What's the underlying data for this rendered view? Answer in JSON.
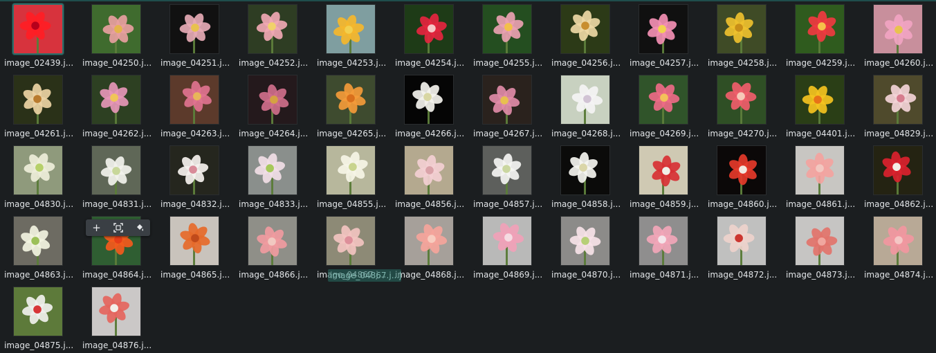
{
  "files": [
    {
      "name": "image_02439.j...",
      "bg": "#d7333d",
      "flower": "#ff1d24",
      "center": "#b7001b",
      "selected": true
    },
    {
      "name": "image_04250.j...",
      "bg": "#3f6b2e",
      "flower": "#e79fa0",
      "center": "#e4b44b"
    },
    {
      "name": "image_04251.j...",
      "bg": "#111111",
      "flower": "#e6aab5",
      "center": "#e8c24e"
    },
    {
      "name": "image_04252.j...",
      "bg": "#2e3d23",
      "flower": "#f0a7b3",
      "center": "#f1d16a"
    },
    {
      "name": "image_04253.j...",
      "bg": "#7f9ea0",
      "flower": "#f5b72b",
      "center": "#f2d04f"
    },
    {
      "name": "image_04254.j...",
      "bg": "#1e3b17",
      "flower": "#e5253f",
      "center": "#f5c7c6"
    },
    {
      "name": "image_04255.j...",
      "bg": "#244e20",
      "flower": "#eaa1b1",
      "center": "#f2c04a"
    },
    {
      "name": "image_04256.j...",
      "bg": "#2c3a17",
      "flower": "#edd8a5",
      "center": "#c88e2f"
    },
    {
      "name": "image_04257.j...",
      "bg": "#101010",
      "flower": "#f38fb3",
      "center": "#f2d34f"
    },
    {
      "name": "image_04258.j...",
      "bg": "#3f4b26",
      "flower": "#eec02e",
      "center": "#c88e18"
    },
    {
      "name": "image_04259.j...",
      "bg": "#2f5b1e",
      "flower": "#f03a40",
      "center": "#f6c14a"
    },
    {
      "name": "image_04260.j...",
      "bg": "#c88f9c",
      "flower": "#f1a4c2",
      "center": "#e8c24e"
    },
    {
      "name": "image_04261.j...",
      "bg": "#2a3118",
      "flower": "#ecd2a4",
      "center": "#b97b2e"
    },
    {
      "name": "image_04262.j...",
      "bg": "#2d4022",
      "flower": "#e696b7",
      "center": "#f0c558"
    },
    {
      "name": "image_04263.j...",
      "bg": "#5c3a2b",
      "flower": "#e0738f",
      "center": "#e8b55a"
    },
    {
      "name": "image_04264.j...",
      "bg": "#24191c",
      "flower": "#cf6e8a",
      "center": "#d5a242"
    },
    {
      "name": "image_04265.j...",
      "bg": "#3e4b2f",
      "flower": "#f39a3a",
      "center": "#d96f1c"
    },
    {
      "name": "image_04266.j...",
      "bg": "#050505",
      "flower": "#f3f2ed",
      "center": "#d8d6a3"
    },
    {
      "name": "image_04267.j...",
      "bg": "#2a221d",
      "flower": "#e08ba7",
      "center": "#e8c04f"
    },
    {
      "name": "image_04268.j...",
      "bg": "#c8d1c0",
      "flower": "#f4f3f4",
      "center": "#d1c3d4"
    },
    {
      "name": "image_04269.j...",
      "bg": "#30542a",
      "flower": "#ed6a86",
      "center": "#f3c15a"
    },
    {
      "name": "image_04270.j...",
      "bg": "#2f4f25",
      "flower": "#f05d6a",
      "center": "#f7c8b8"
    },
    {
      "name": "image_04401.j...",
      "bg": "#2a3e16",
      "flower": "#f4c21f",
      "center": "#e87218"
    },
    {
      "name": "image_04829.j...",
      "bg": "#4f4a2c",
      "flower": "#f3d2d7",
      "center": "#d67c8e"
    },
    {
      "name": "image_04830.j...",
      "bg": "#8f9a7c",
      "flower": "#eeeed9",
      "center": "#b6d06a"
    },
    {
      "name": "image_04831.j...",
      "bg": "#5f6757",
      "flower": "#f2f2ec",
      "center": "#c8d79a"
    },
    {
      "name": "image_04832.j...",
      "bg": "#25261e",
      "flower": "#f5f1ee",
      "center": "#d88a98"
    },
    {
      "name": "image_04833.j...",
      "bg": "#8a8f8c",
      "flower": "#f1dee6",
      "center": "#a6c85a"
    },
    {
      "name": "image_04855.j...",
      "bg": "#b7b79c",
      "flower": "#f5f4e6",
      "center": "#c9d48e"
    },
    {
      "name": "image_04856.j...",
      "bg": "#b4a98f",
      "flower": "#f3cfd3",
      "center": "#d9a2a8"
    },
    {
      "name": "image_04857.j...",
      "bg": "#5d5f5c",
      "flower": "#f4f4f2",
      "center": "#cad6a0"
    },
    {
      "name": "image_04858.j...",
      "bg": "#0b0b0a",
      "flower": "#f5f5f0",
      "center": "#dad6a8"
    },
    {
      "name": "image_04859.j...",
      "bg": "#cfc9b3",
      "flower": "#d83034",
      "center": "#f0efe8"
    },
    {
      "name": "image_04860.j...",
      "bg": "#0b0808",
      "flower": "#e53a2a",
      "center": "#f2e8e0"
    },
    {
      "name": "image_04861.j...",
      "bg": "#c8c6c2",
      "flower": "#f3a3a0",
      "center": "#f2c7c0"
    },
    {
      "name": "image_04862.j...",
      "bg": "#242312",
      "flower": "#db222e",
      "center": "#f4eee6"
    },
    {
      "name": "image_04863.j...",
      "bg": "#6d6b62",
      "flower": "#f2f3df",
      "center": "#9cc058"
    },
    {
      "name": "image_04864.j...",
      "bg": "#2f5e32",
      "flower": "#f35a1c",
      "center": "#e43d18"
    },
    {
      "name": "image_04865.j...",
      "bg": "#c9c3bc",
      "flower": "#e66a2a",
      "center": "#c04a1b"
    },
    {
      "name": "image_04866.j...",
      "bg": "#8f8f88",
      "flower": "#f09ba0",
      "center": "#f1c9c1"
    },
    {
      "name": "image_04867.j...",
      "bg": "#8d8a76",
      "flower": "#f2c3c0",
      "center": "#dd8f9a"
    },
    {
      "name": "image_04868.j...",
      "bg": "#a6a09a",
      "flower": "#f5a49b",
      "center": "#f7ccbf"
    },
    {
      "name": "image_04869.j...",
      "bg": "#b9b9b8",
      "flower": "#f0a1b7",
      "center": "#f5dbe2"
    },
    {
      "name": "image_04870.j...",
      "bg": "#8c8b89",
      "flower": "#f6e2e7",
      "center": "#b6cf77"
    },
    {
      "name": "image_04871.j...",
      "bg": "#8f8e8e",
      "flower": "#f2a6b8",
      "center": "#f4e5ea"
    },
    {
      "name": "image_04872.j...",
      "bg": "#c0c0bf",
      "flower": "#eed2cc",
      "center": "#cc3630"
    },
    {
      "name": "image_04873.j...",
      "bg": "#c6c5c3",
      "flower": "#e2736b",
      "center": "#f0a79f"
    },
    {
      "name": "image_04874.j...",
      "bg": "#b8a996",
      "flower": "#f197a0",
      "center": "#f4c7c5"
    },
    {
      "name": "image_04875.j...",
      "bg": "#5d7a3a",
      "flower": "#f0f0ed",
      "center": "#d73637"
    },
    {
      "name": "image_04876.j...",
      "bg": "#cbc8c7",
      "flower": "#e5655d",
      "center": "#f2efea"
    }
  ],
  "hover_toolbar": {
    "buttons": [
      {
        "name": "add-button",
        "icon": "plus-icon",
        "glyph": "+"
      },
      {
        "name": "select-button",
        "icon": "select-frame-icon",
        "glyph": "⛶"
      },
      {
        "name": "paint-button",
        "icon": "paint-bucket-icon",
        "glyph": "⛽"
      }
    ]
  },
  "drag_ghost": {
    "label": "image_04867.j...jpg"
  }
}
